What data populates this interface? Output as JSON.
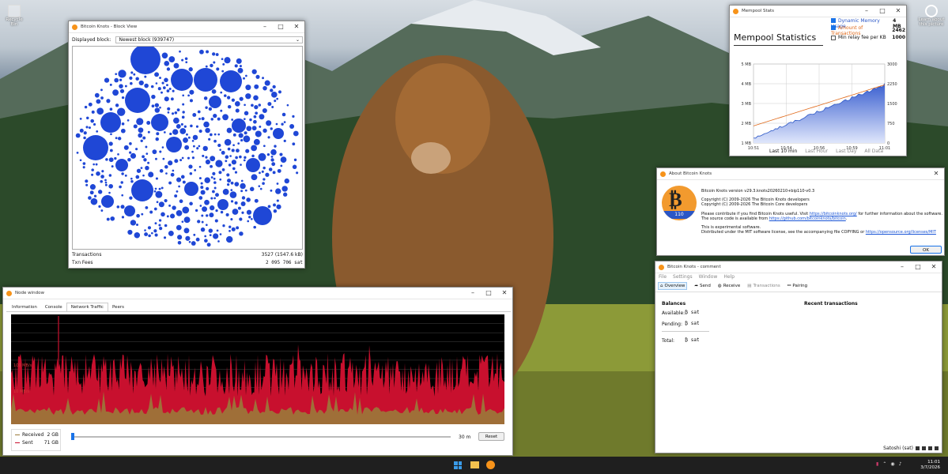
{
  "desktop": {
    "recycle_bin": "Recycle Bin",
    "learn": "Learn about this picture"
  },
  "block_view": {
    "title": "Bitcoin Knots - Block View",
    "displayed_label": "Displayed block:",
    "displayed_value": "Newest block (939747)",
    "transactions_label": "Transactions",
    "transactions_value": "3527 (1547.6 kB)",
    "fees_label": "Txn Fees",
    "fees_value": "2 095 706 sat"
  },
  "mempool": {
    "title": "Mempool Stats",
    "heading": "Mempool Statistics",
    "legend": [
      {
        "label": "Dynamic Memory Usage",
        "value": "4 MB",
        "checked": true,
        "color": "#2a56c6"
      },
      {
        "label": "Amount of Transactions",
        "value": "2462",
        "checked": true,
        "color": "#e06a1b"
      },
      {
        "label": "Min relay fee per KB",
        "value": "1000",
        "checked": false,
        "color": "#222"
      }
    ],
    "y_left": [
      "5 MB",
      "4 MB",
      "3 MB",
      "2 MB",
      "1 MB"
    ],
    "y_right": [
      "3000",
      "2250",
      "1500",
      "750",
      "0"
    ],
    "x_ticks": [
      "10:51",
      "10:54",
      "10:56",
      "10:59",
      "11:01"
    ],
    "ranges": [
      {
        "label": "Last 10 min",
        "active": true
      },
      {
        "label": "Last Hour",
        "active": false
      },
      {
        "label": "Last Day",
        "active": false
      },
      {
        "label": "All Data",
        "active": false
      }
    ]
  },
  "about": {
    "title": "About Bitcoin Knots",
    "logo_text": "110",
    "version": "Bitcoin Knots version v29.3.knots20260210+bip110-v0.3",
    "copy1": "Copyright (C) 2009-2026 The Bitcoin Knots developers",
    "copy2": "Copyright (C) 2009-2026 The Bitcoin Core developers",
    "contrib_a": "Please contribute if you find Bitcoin Knots useful. Visit ",
    "contrib_link": "https://bitcoinknots.org/",
    "contrib_b": " for further information about the software.",
    "src_a": "The source code is available from ",
    "src_link": "https://github.com/bitcoinknots/bitcoin",
    "src_b": ".",
    "exp": "This is experimental software.",
    "mit_a": "Distributed under the MIT software license, see the accompanying file COPYING or ",
    "mit_link": "https://opensource.org/licenses/MIT",
    "ok": "OK"
  },
  "wallet": {
    "title": "Bitcoin Knots - comment",
    "menu": [
      "File",
      "Settings",
      "Window",
      "Help"
    ],
    "tools": [
      "Overview",
      "Send",
      "Receive",
      "Transactions",
      "Pairing"
    ],
    "balances": "Balances",
    "recent": "Recent transactions",
    "available_label": "Available:",
    "available_value": "₿ sat",
    "pending_label": "Pending:",
    "pending_value": "₿ sat",
    "total_label": "Total:",
    "total_value": "₿ sat",
    "status": "Satoshi (sat)"
  },
  "node": {
    "title": "Node window",
    "tabs": [
      "Information",
      "Console",
      "Network Traffic",
      "Peers"
    ],
    "grid_labels": [
      "100 MB/s",
      "10 MB/s"
    ],
    "received_label": "Received",
    "received_value": "2 GB",
    "sent_label": "Sent",
    "sent_value": "71 GB",
    "span": "30 m",
    "reset": "Reset"
  },
  "taskbar": {
    "time": "11:01",
    "date": "3/7/2026"
  },
  "colors": {
    "sent": "#c8102e",
    "received": "#9a7a3a",
    "bubble": "#1f47d6",
    "accent": "#1a73e8"
  }
}
